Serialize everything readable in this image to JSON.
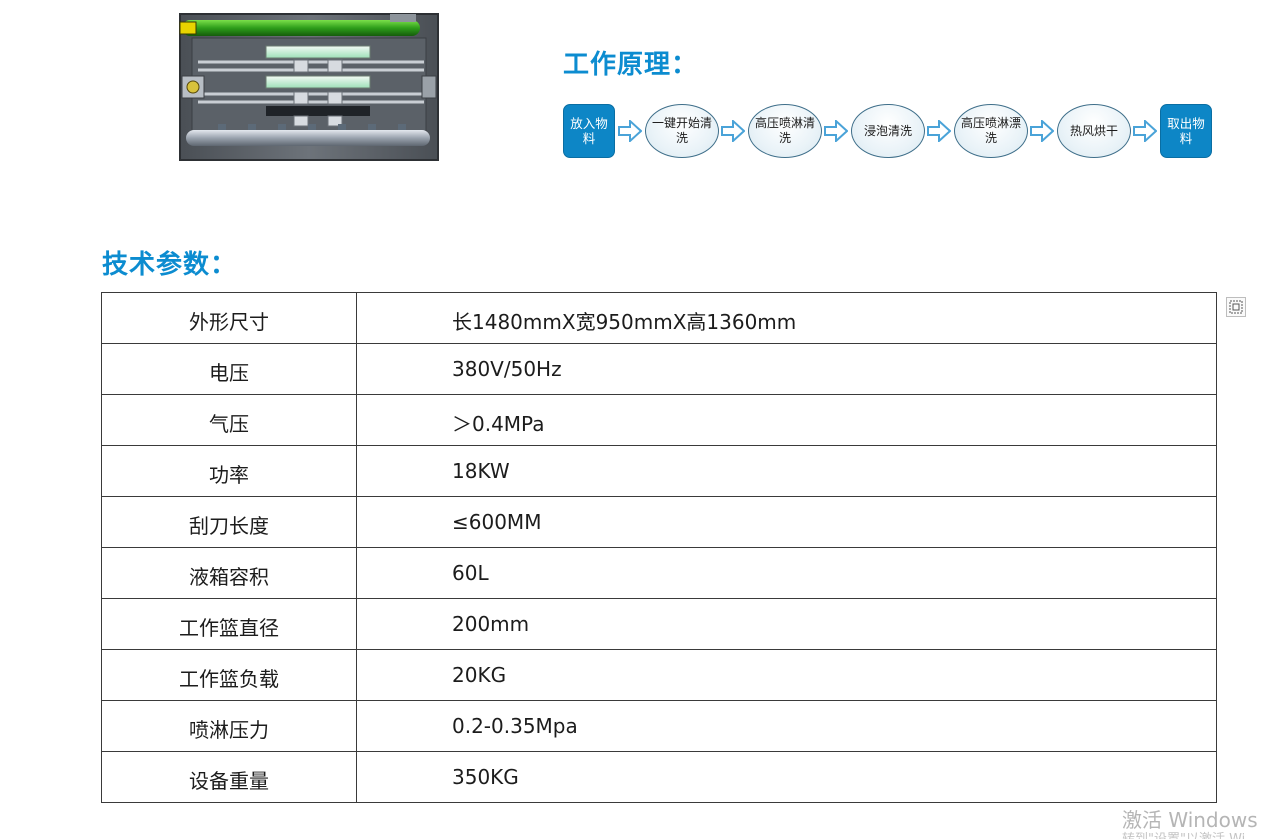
{
  "principle": {
    "title": "工作原理：",
    "steps": [
      {
        "kind": "box",
        "label": "放入物料"
      },
      {
        "kind": "oval",
        "label": "一键开始清洗"
      },
      {
        "kind": "oval",
        "label": "高压喷淋清洗"
      },
      {
        "kind": "oval",
        "label": "浸泡清洗"
      },
      {
        "kind": "oval",
        "label": "高压喷淋漂洗"
      },
      {
        "kind": "oval",
        "label": "热风烘干"
      },
      {
        "kind": "box",
        "label": "取出物料"
      }
    ],
    "box_color": "#0d86c6",
    "arrow_color": "#4aa3d8"
  },
  "specs": {
    "title": "技术参数：",
    "rows": [
      {
        "name": "外形尺寸",
        "value": "长1480mmX宽950mmX高1360mm"
      },
      {
        "name": "电压",
        "value": "380V/50Hz"
      },
      {
        "name": "气压",
        "value": "＞0.4MPa"
      },
      {
        "name": "功率",
        "value": "18KW"
      },
      {
        "name": "刮刀长度",
        "value": "≤600MM"
      },
      {
        "name": "液箱容积",
        "value": "60L"
      },
      {
        "name": "工作篮直径",
        "value": "200mm"
      },
      {
        "name": "工作篮负载",
        "value": "20KG"
      },
      {
        "name": "喷淋压力",
        "value": "0.2-0.35Mpa"
      },
      {
        "name": "设备重量",
        "value": "350KG"
      }
    ]
  },
  "watermark": {
    "line1": "激活 Windows",
    "line2": "转到\"设置\"以激活 Wi"
  },
  "colors": {
    "title_blue": "#0c8cd0",
    "border": "#3a3a3a"
  }
}
